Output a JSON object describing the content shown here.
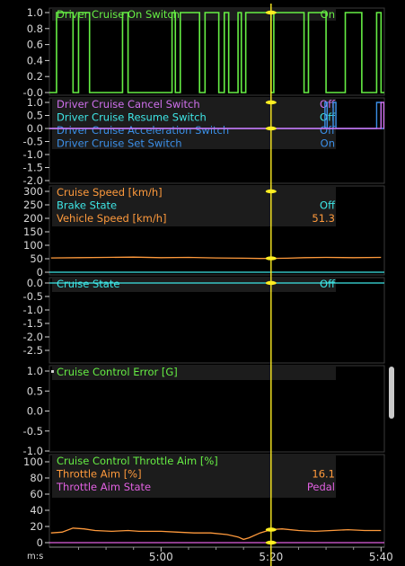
{
  "x_axis": {
    "unit_label": "m:s",
    "ticks": [
      {
        "label": "5:00",
        "t": 300
      },
      {
        "label": "5:20",
        "t": 320
      },
      {
        "label": "5:40",
        "t": 340
      }
    ]
  },
  "cursor": {
    "t": 320,
    "color": "#ffee22"
  },
  "panels": [
    {
      "id": "p1",
      "yticks": [
        "1.0",
        "0.8",
        "0.6",
        "0.4",
        "0.2",
        "-0.0"
      ],
      "legend": [
        {
          "label": "Driver Cruise On Switch",
          "value": "On",
          "color": "#66ee44"
        }
      ]
    },
    {
      "id": "p2",
      "yticks": [
        "1.0",
        "0.5",
        "0.0",
        "-0.5",
        "-1.0",
        "-1.5",
        "-2.0"
      ],
      "legend": [
        {
          "label": "Driver Cruise Cancel Switch",
          "value": "Off",
          "color": "#d070ee"
        },
        {
          "label": "Driver Cruise Resume Switch",
          "value": "Off",
          "color": "#3ee6e6"
        },
        {
          "label": "Driver Cruise Acceleration Switch",
          "value": "Off",
          "color": "#3b8fe8"
        },
        {
          "label": "Driver Cruise Set Switch",
          "value": "On",
          "color": "#3b8fe8"
        }
      ]
    },
    {
      "id": "p3",
      "yticks": [
        "300",
        "250",
        "200",
        "150",
        "100",
        "50",
        "0"
      ],
      "legend": [
        {
          "label": "Cruise Speed [km/h]",
          "value": "",
          "color": "#ff9a3c"
        },
        {
          "label": "Brake State",
          "value": "Off",
          "color": "#3ee6e6"
        },
        {
          "label": "Vehicle Speed [km/h]",
          "value": "51.3",
          "color": "#ff9a3c"
        }
      ]
    },
    {
      "id": "p4",
      "yticks": [
        "0.0",
        "-0.5",
        "-1.0",
        "-1.5",
        "-2.0",
        "-2.5"
      ],
      "legend": [
        {
          "label": "Cruise State",
          "value": "Off",
          "color": "#3ee6e6"
        }
      ]
    },
    {
      "id": "p5",
      "yticks": [
        "1.0",
        "0.5",
        "0.0",
        "-0.5",
        "-1.0"
      ],
      "legend": [
        {
          "label": "Cruise Control Error [G]",
          "value": "",
          "color": "#66ee44"
        }
      ]
    },
    {
      "id": "p6",
      "yticks": [
        "100",
        "80",
        "60",
        "40",
        "20",
        "0"
      ],
      "legend": [
        {
          "label": "Cruise Control Throttle Aim [%]",
          "value": "",
          "color": "#66ee44"
        },
        {
          "label": "Throttle Aim [%]",
          "value": "16.1",
          "color": "#ff9a3c"
        },
        {
          "label": "Throttle Aim State",
          "value": "Pedal",
          "color": "#e060e0"
        }
      ]
    }
  ],
  "series": {
    "cruise_on_switch": {
      "color": "#66ee44",
      "intervals_on": [
        [
          281,
          284
        ],
        [
          285,
          287
        ],
        [
          293,
          294
        ],
        [
          302,
          302.6
        ],
        [
          303.5,
          307
        ],
        [
          308,
          310.5
        ],
        [
          311.5,
          312.3
        ],
        [
          314,
          314.6
        ],
        [
          315.4,
          320
        ],
        [
          320.5,
          326
        ],
        [
          326.8,
          330
        ],
        [
          333.5,
          336.5
        ],
        [
          339.2,
          340
        ]
      ]
    },
    "set_switch": {
      "color": "#3b8fe8",
      "intervals_on": [
        [
          329.8,
          330.2
        ],
        [
          331.3,
          331.8
        ],
        [
          339.2,
          340
        ]
      ]
    },
    "cancel_switch": {
      "color": "#d070ee",
      "intervals_on": [
        [
          340,
          340.5
        ]
      ]
    },
    "vehicle_speed": {
      "color": "#ff9a3c",
      "points": [
        [
          280,
          53
        ],
        [
          285,
          54
        ],
        [
          290,
          55
        ],
        [
          295,
          56
        ],
        [
          300,
          54
        ],
        [
          305,
          55
        ],
        [
          310,
          53
        ],
        [
          315,
          52
        ],
        [
          318,
          51
        ],
        [
          320,
          51.3
        ],
        [
          323,
          52
        ],
        [
          326,
          54
        ],
        [
          330,
          55
        ],
        [
          335,
          54
        ],
        [
          340,
          55
        ]
      ]
    },
    "brake_state": {
      "color": "#3ee6e6",
      "value": 0
    },
    "cruise_state": {
      "color": "#3ee6e6",
      "value": 0
    },
    "throttle_aim": {
      "color": "#ff9a3c",
      "points": [
        [
          280,
          12
        ],
        [
          282,
          13
        ],
        [
          284,
          18
        ],
        [
          286,
          17
        ],
        [
          288,
          15
        ],
        [
          291,
          14
        ],
        [
          294,
          15
        ],
        [
          296,
          14
        ],
        [
          300,
          14
        ],
        [
          303,
          13
        ],
        [
          306,
          12
        ],
        [
          309,
          12
        ],
        [
          312,
          10
        ],
        [
          314,
          7
        ],
        [
          315,
          4
        ],
        [
          316,
          6
        ],
        [
          318,
          12
        ],
        [
          320,
          16.1
        ],
        [
          322,
          17
        ],
        [
          325,
          15
        ],
        [
          328,
          14
        ],
        [
          331,
          15
        ],
        [
          334,
          16
        ],
        [
          337,
          15
        ],
        [
          340,
          15
        ]
      ]
    },
    "throttle_aim_state": {
      "color": "#e060e0",
      "value": 0
    }
  }
}
